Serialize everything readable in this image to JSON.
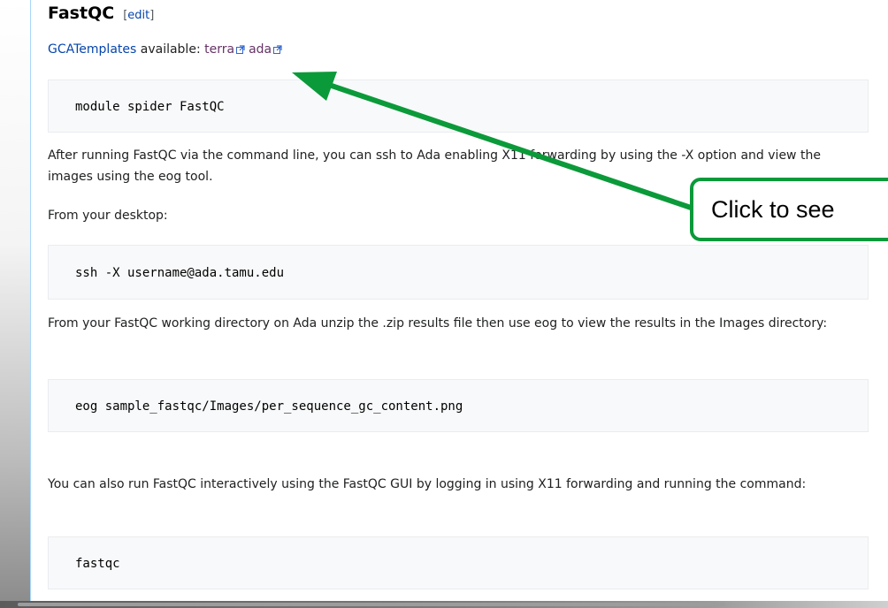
{
  "section": {
    "title": "FastQC",
    "edit_open": "[",
    "edit_label": "edit",
    "edit_close": "]"
  },
  "templates": {
    "link_label": "GCATemplates",
    "available_text": " available: ",
    "terra_label": "terra",
    "ada_label": "ada"
  },
  "code_blocks": {
    "module_spider": "module spider FastQC",
    "ssh": "ssh -X username@ada.tamu.edu",
    "eog": "eog sample_fastqc/Images/per_sequence_gc_content.png",
    "fastqc": "fastqc"
  },
  "paragraphs": {
    "after_running": "After running FastQC via the command line, you can ssh to Ada enabling X11 forwarding by using the -X option and view the images using the eog tool.",
    "from_desktop": "From your desktop:",
    "from_working_dir": "From your FastQC working directory on Ada unzip the .zip results file then use eog to view the results in the Images directory:",
    "interactive": "You can also run FastQC interactively using the FastQC GUI by logging in using X11 forwarding and running the command:"
  },
  "annotation": {
    "callout_text": "Click to see",
    "arrow_color": "#0b9a3a"
  },
  "colors": {
    "link": "#0645ad",
    "visited_external_link": "#663366",
    "code_background": "#f8f9fa"
  }
}
